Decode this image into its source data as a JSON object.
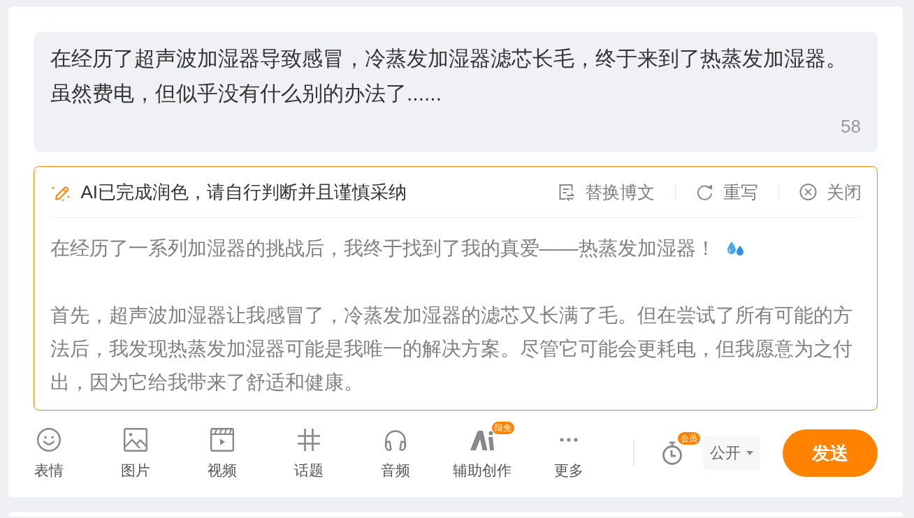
{
  "composer": {
    "lines": [
      "在经历了超声波加湿器导致感冒，冷蒸发加湿器滤芯长毛，终于来到了热蒸发加湿器。",
      "虽然费电，但似乎没有什么别的办法了......"
    ],
    "char_count": "58"
  },
  "ai_panel": {
    "title": "AI已完成润色，请自行判断并且谨慎采纳",
    "actions": [
      {
        "kind": "replace",
        "label": "替换博文"
      },
      {
        "kind": "rewrite",
        "label": "重写"
      },
      {
        "kind": "close",
        "label": "关闭"
      }
    ],
    "paragraphs": [
      {
        "kind": "emoji",
        "text": "在经历了一系列加湿器的挑战后，我终于找到了我的真爱——热蒸发加湿器！"
      },
      {
        "kind": "plain",
        "text": "首先，超声波加湿器让我感冒了，冷蒸发加湿器的滤芯又长满了毛。但在尝试了所有可能的方法后，我发现热蒸发加湿器可能是我唯一的解决方案。尽管它可能会更耗电，但我愿意为之付出，因为它给我带来了舒适和健康。"
      }
    ]
  },
  "toolbar": {
    "tools": [
      {
        "kind": "emoji",
        "label": "表情"
      },
      {
        "kind": "image",
        "label": "图片"
      },
      {
        "kind": "video",
        "label": "视频"
      },
      {
        "kind": "topic",
        "label": "话题"
      },
      {
        "kind": "audio",
        "label": "音频"
      },
      {
        "kind": "ai",
        "label": "辅助创作",
        "badge": "限免"
      },
      {
        "kind": "more",
        "label": "更多"
      }
    ],
    "schedule": {
      "badge": "会员"
    },
    "visibility": "公开",
    "send": "发送"
  }
}
